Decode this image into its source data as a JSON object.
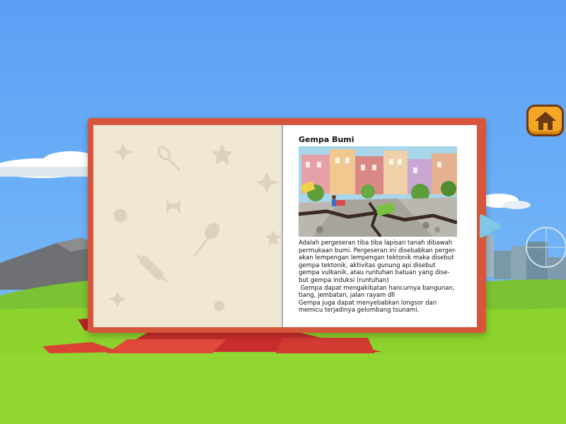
{
  "book": {
    "title": "Gempa Bumi",
    "illustration": "earthquake-city-illustration",
    "paragraphs": [
      "Adalah pergeseran tiba tiba lapisan tanah dibawah",
      "permukaan bumi. Pergeseran ini disebabkan perger-",
      "akan lempengan lempengan tektonik maka disebut",
      "gempa tektonik, aktivitas gunung api disebut",
      "gempa vulkanik, atau runtuhan batuan yang dise-",
      "but gempa induksi (runtuhan)",
      " Gempa dapat mengakibatan hancurnya bangunan,",
      "tiang, jembatan, jalan rayam dll",
      "Gempa juga dapat menyebabkan longsor dan",
      "memicu terjadinya gelombang tsunami."
    ]
  },
  "controls": {
    "home_icon": "home-icon",
    "next_icon": "play-arrow-icon"
  },
  "colors": {
    "sky": "#5aa0f5",
    "grass": "#8cd32d",
    "book_cover": "#d5563a",
    "home_button": "#f4a624",
    "next_button": "#7ec8e6"
  }
}
